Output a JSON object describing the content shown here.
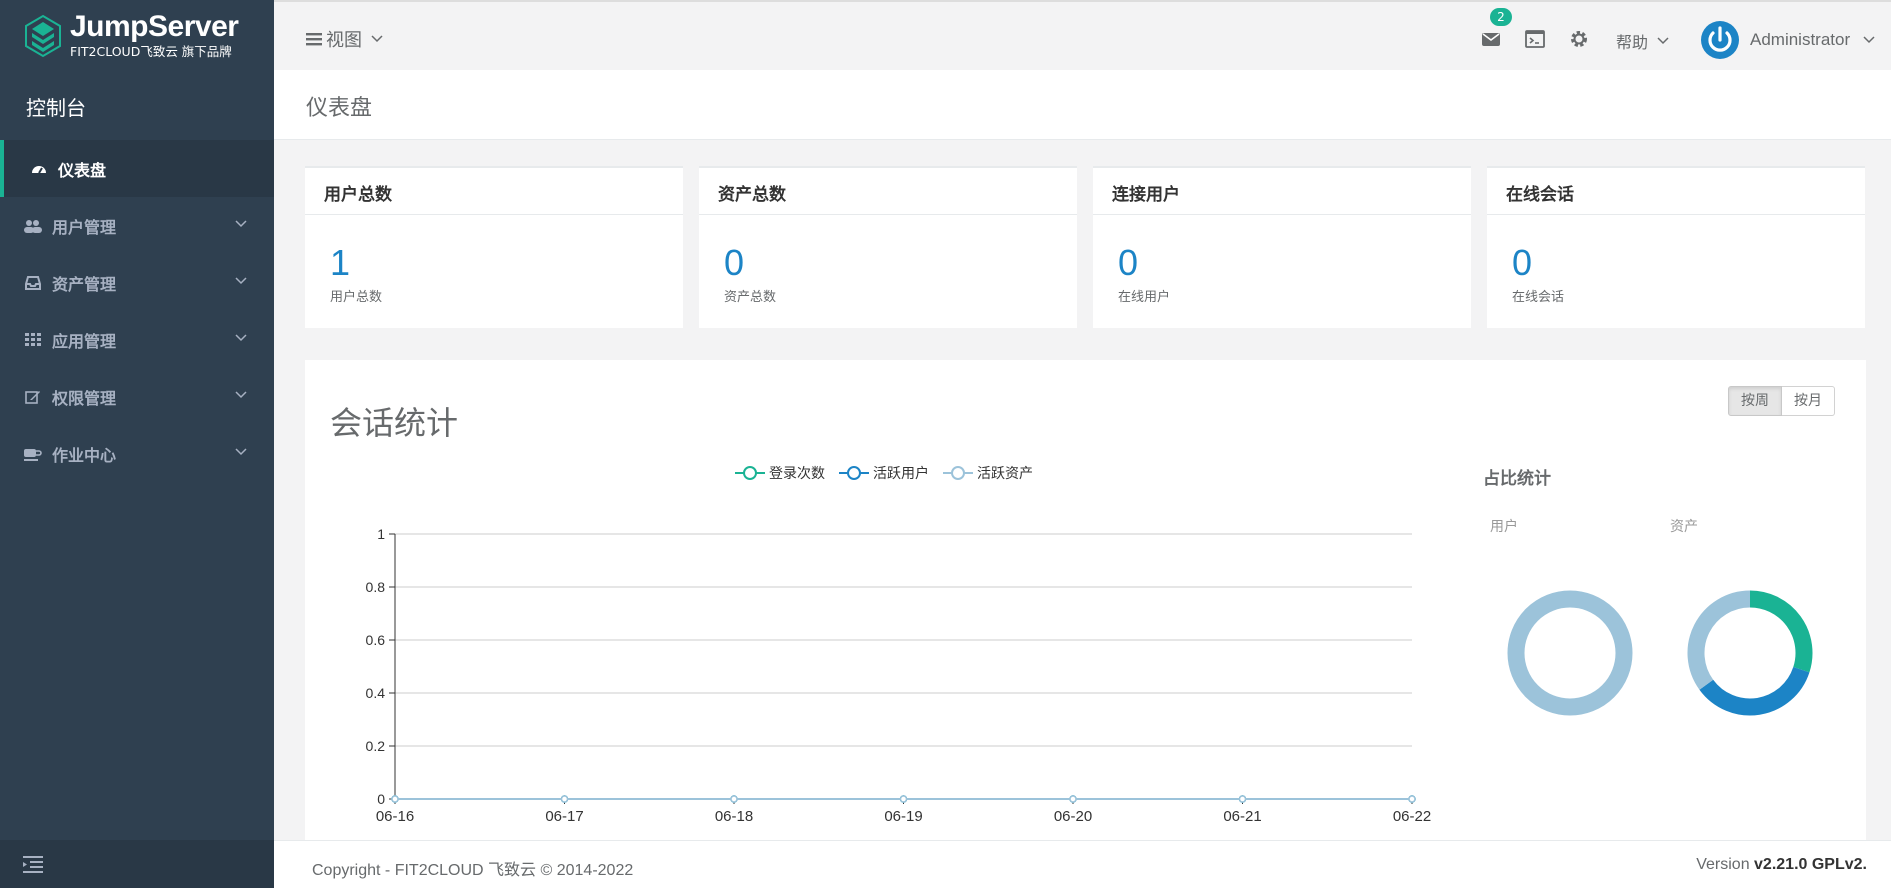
{
  "brand": {
    "name": "JumpServer",
    "sub": "FIT2CLOUD飞致云 旗下品牌"
  },
  "sidebar": {
    "console_label": "控制台",
    "items": [
      {
        "label": "仪表盘",
        "icon": "dashboard-icon",
        "active": true
      },
      {
        "label": "用户管理",
        "icon": "users-icon"
      },
      {
        "label": "资产管理",
        "icon": "inbox-icon"
      },
      {
        "label": "应用管理",
        "icon": "grid-icon"
      },
      {
        "label": "权限管理",
        "icon": "edit-icon"
      },
      {
        "label": "作业中心",
        "icon": "coffee-icon"
      }
    ]
  },
  "topbar": {
    "view_label": "视图",
    "message_count": "2",
    "help_label": "帮助",
    "user_name": "Administrator"
  },
  "page": {
    "title": "仪表盘"
  },
  "cards": [
    {
      "title": "用户总数",
      "value": "1",
      "sub": "用户总数"
    },
    {
      "title": "资产总数",
      "value": "0",
      "sub": "资产总数"
    },
    {
      "title": "连接用户",
      "value": "0",
      "sub": "在线用户"
    },
    {
      "title": "在线会话",
      "value": "0",
      "sub": "在线会话"
    }
  ],
  "session_stats": {
    "title": "会话统计",
    "toggle": {
      "week_label": "按周",
      "month_label": "按月",
      "selected": "按周"
    },
    "ratio_title": "占比统计",
    "ratio_user_label": "用户",
    "ratio_asset_label": "资产"
  },
  "chart_data": {
    "type": "line",
    "x": [
      "06-16",
      "06-17",
      "06-18",
      "06-19",
      "06-20",
      "06-21",
      "06-22"
    ],
    "y_ticks": [
      0,
      0.2,
      0.4,
      0.6,
      0.8,
      1
    ],
    "ylim": [
      0,
      1
    ],
    "grid": true,
    "legend_position": "top",
    "series": [
      {
        "name": "登录次数",
        "values": [
          0,
          0,
          0,
          0,
          0,
          0,
          0
        ],
        "color": "#1ab394"
      },
      {
        "name": "活跃用户",
        "values": [
          0,
          0,
          0,
          0,
          0,
          0,
          0
        ],
        "color": "#1c84c6"
      },
      {
        "name": "活跃资产",
        "values": [
          0,
          0,
          0,
          0,
          0,
          0,
          0
        ],
        "color": "#9cc3da"
      }
    ]
  },
  "donut_data": {
    "user": {
      "type": "pie",
      "values": [
        1
      ],
      "colors": [
        "#9cc3da"
      ]
    },
    "asset": {
      "type": "pie",
      "values": [
        0.3,
        0.35,
        0.35
      ],
      "colors": [
        "#1ab394",
        "#1c84c6",
        "#9cc3da"
      ]
    }
  },
  "footer": {
    "copyright": "Copyright - FIT2CLOUD 飞致云 © 2014-2022",
    "version_prefix": "Version ",
    "version": "v2.21.0 GPLv2."
  }
}
